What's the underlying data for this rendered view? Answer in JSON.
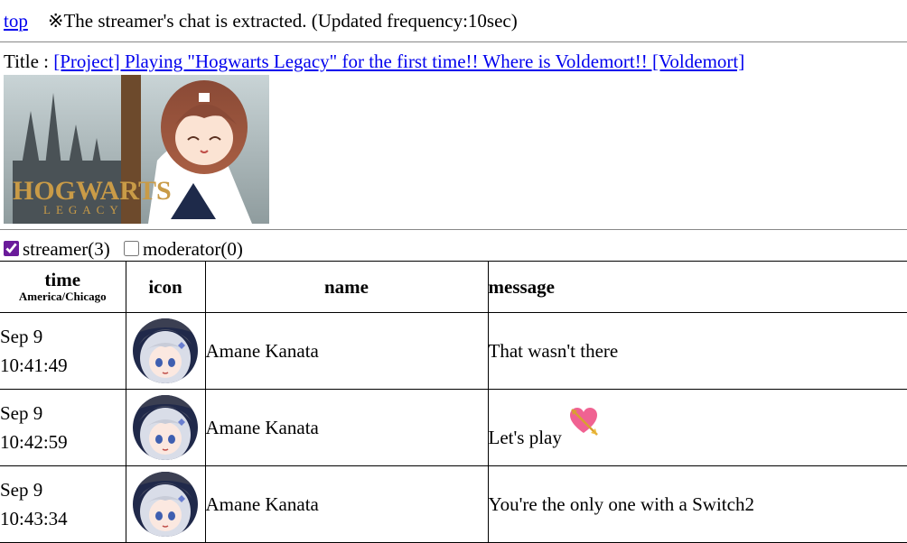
{
  "header": {
    "top_link": "top",
    "notice": "※The streamer's chat is extracted. (Updated frequency:10sec)"
  },
  "stream": {
    "title_label": "Title : ",
    "title_link": "[Project] Playing \"Hogwarts Legacy\" for the first time!! Where is Voldemort!! [Voldemort]",
    "thumbnail_logo": "HOGWARTS",
    "thumbnail_logo_sub": "LEGACY"
  },
  "filters": {
    "streamer_label": "streamer(3)",
    "streamer_checked": true,
    "moderator_label": "moderator(0)",
    "moderator_checked": false
  },
  "table": {
    "col_time": "time",
    "col_time_tz": "America/Chicago",
    "col_icon": "icon",
    "col_name": "name",
    "col_message": "message",
    "rows": [
      {
        "date": "Sep 9",
        "time": "10:41:49",
        "name": "Amane Kanata",
        "message": "That wasn't there",
        "emoji": ""
      },
      {
        "date": "Sep 9",
        "time": "10:42:59",
        "name": "Amane Kanata",
        "message": "Let's play",
        "emoji": "heart-with-arrow"
      },
      {
        "date": "Sep 9",
        "time": "10:43:34",
        "name": "Amane Kanata",
        "message": "You're the only one with a Switch2",
        "emoji": ""
      }
    ]
  },
  "colors": {
    "link": "#0000ee",
    "checkbox_accent": "#6a1b9a",
    "avatar_bg": "#20294a",
    "avatar_hair": "#d9dde8",
    "heart": "#f06292"
  }
}
